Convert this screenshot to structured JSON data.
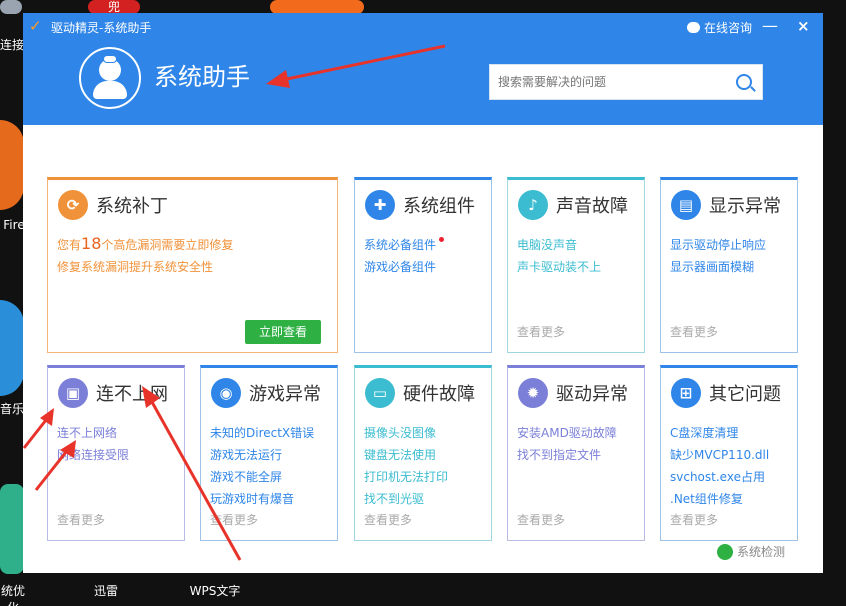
{
  "desktop": {
    "icons": [
      "连接",
      "Fire",
      "音乐",
      "统优化",
      "迅雷",
      "WPS文字"
    ],
    "top_tile_text": "兜"
  },
  "window": {
    "title": "驱动精灵-系统助手",
    "consult_label": "在线咨询",
    "minimize_label": "—",
    "close_label": "×"
  },
  "header": {
    "title": "系统助手",
    "search_placeholder": "搜索需要解决的问题"
  },
  "patch_card": {
    "title": "系统补丁",
    "line1_prefix": "您有",
    "line1_count": "18",
    "line1_suffix": "个高危漏洞需要立即修复",
    "line2": "修复系统漏洞提升系统安全性",
    "button_label": "立即查看"
  },
  "cards": [
    {
      "title": "系统组件",
      "links": [
        "系统必备组件",
        "游戏必备组件"
      ],
      "more": ""
    },
    {
      "title": "声音故障",
      "links": [
        "电脑没声音",
        "声卡驱动装不上"
      ],
      "more": "查看更多"
    },
    {
      "title": "显示异常",
      "links": [
        "显示驱动停止响应",
        "显示器画面模糊"
      ],
      "more": "查看更多"
    },
    {
      "title": "连不上网",
      "links": [
        "连不上网络",
        "网络连接受限"
      ],
      "more": "查看更多"
    },
    {
      "title": "游戏异常",
      "links": [
        "未知的DirectX错误",
        "游戏无法运行",
        "游戏不能全屏",
        "玩游戏时有爆音"
      ],
      "more": "查看更多"
    },
    {
      "title": "硬件故障",
      "links": [
        "摄像头没图像",
        "键盘无法使用",
        "打印机无法打印",
        "找不到光驱"
      ],
      "more": "查看更多"
    },
    {
      "title": "驱动异常",
      "links": [
        "安装AMD驱动故障",
        "找不到指定文件"
      ],
      "more": "查看更多"
    },
    {
      "title": "其它问题",
      "links": [
        "C盘深度清理",
        "缺少MVCP110.dll",
        "svchost.exe占用",
        ".Net组件修复"
      ],
      "more": "查看更多"
    }
  ],
  "footer": {
    "detect_label": "系统检测"
  },
  "colors": {
    "primary": "#2f86e8",
    "orange": "#f0923a",
    "green": "#2eb043",
    "annotation_red": "#e8332a"
  }
}
